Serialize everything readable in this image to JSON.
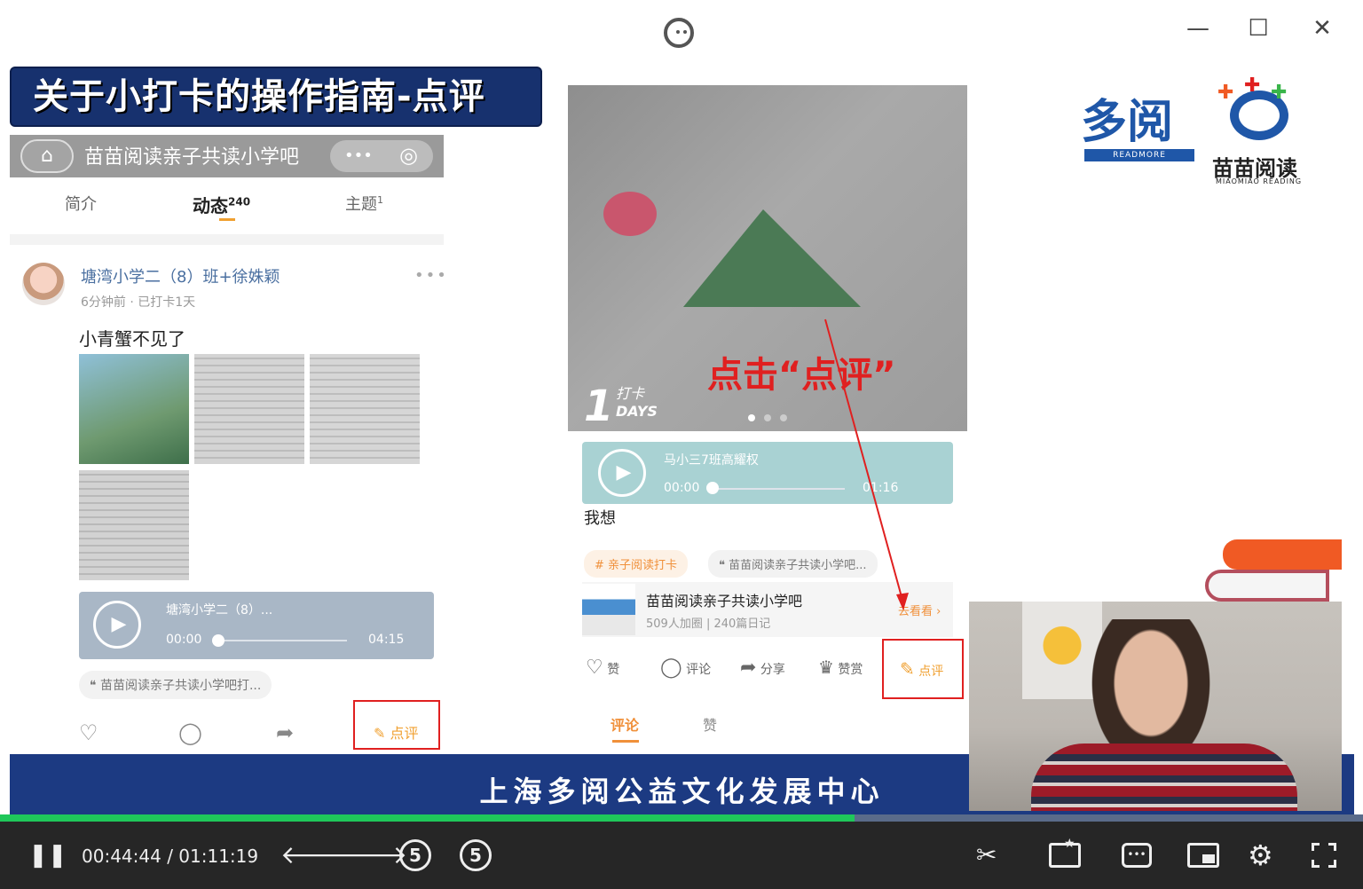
{
  "window": {
    "minimize_icon": "—",
    "maximize_icon": "☐",
    "close_icon": "✕"
  },
  "slide": {
    "banner_title": "关于小打卡的操作指南-点评",
    "bottom_org": "上海多阅公益文化发展中心",
    "click_hint": "点击“点评”",
    "logo_duoyue": "多阅",
    "logo_readmore": "READMORE",
    "logo_miaomiao": "苗苗阅读",
    "logo_miaomiao_en": "MIAOMIAO READING"
  },
  "left_phone": {
    "title": "苗苗阅读亲子共读小学吧",
    "capsule_more": "•••",
    "tabs": [
      {
        "label": "简介"
      },
      {
        "label": "动态",
        "count": "240"
      },
      {
        "label": "主题",
        "count": "1"
      }
    ],
    "post": {
      "author": "塘湾小学二（8）班+徐姝颖",
      "meta": "6分钟前 · 已打卡1天",
      "text": "小青蟹不见了",
      "audio_name": "塘湾小学二（8）...",
      "audio_start": "00:00",
      "audio_end": "04:15",
      "tag": "苗苗阅读亲子共读小学吧打...",
      "review_label": "点评"
    }
  },
  "mid_phone": {
    "days_number": "1",
    "days_label_top": "打卡",
    "days_label_bottom": "DAYS",
    "audio_name": "马小三7班高耀权",
    "audio_start": "00:00",
    "audio_end": "01:16",
    "text": "我想",
    "tag_orange": "亲子阅读打卡",
    "tag_grey": "苗苗阅读亲子共读小学吧...",
    "card_title": "苗苗阅读亲子共读小学吧",
    "card_meta": "509人加圈 | 240篇日记",
    "card_link": "去看看",
    "actions": {
      "like": "赞",
      "comment": "评论",
      "share": "分享",
      "reward": "赞赏",
      "review": "点评"
    },
    "bottom_tabs": {
      "comments": "评论",
      "likes": "赞"
    }
  },
  "player": {
    "current_time": "00:44:44",
    "separator": "/",
    "total_time": "01:11:19",
    "progress_fraction": 0.627,
    "rewind_label": "5",
    "forward_label": "5"
  },
  "colors": {
    "banner_bg": "#17316e",
    "progress": "#1fc75a",
    "accent_red": "#e02020",
    "accent_orange": "#f0a030"
  }
}
